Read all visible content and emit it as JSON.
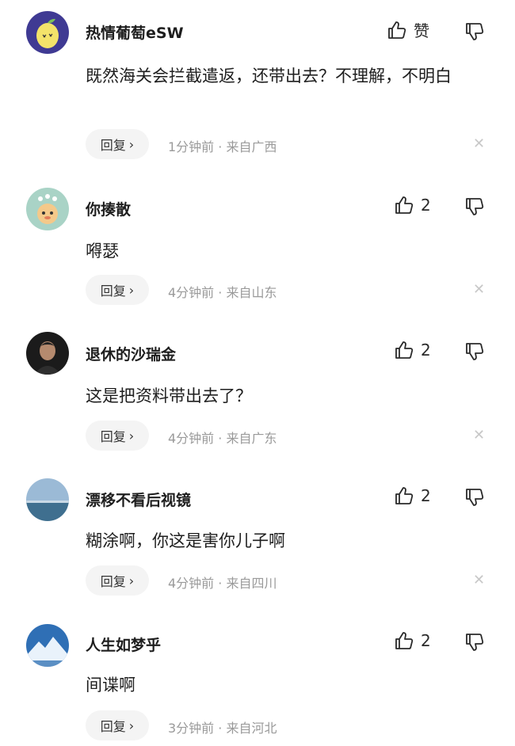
{
  "reply_label": "回复",
  "comments": [
    {
      "user": "热情葡萄eSW",
      "like_label": "赞",
      "text": "既然海关会拦截遣返，还带出去？不理解，不明白",
      "time": "1分钟前",
      "sep": "·",
      "location": "来自广西"
    },
    {
      "user": "你揍散",
      "like_label": "2",
      "text": "嘚瑟",
      "time": "4分钟前",
      "sep": "·",
      "location": "来自山东"
    },
    {
      "user": "退休的沙瑞金",
      "like_label": "2",
      "text": "这是把资料带出去了？",
      "time": "4分钟前",
      "sep": "·",
      "location": "来自广东"
    },
    {
      "user": "漂移不看后视镜",
      "like_label": "2",
      "text": "糊涂啊，你这是害你儿子啊",
      "time": "4分钟前",
      "sep": "·",
      "location": "来自四川"
    },
    {
      "user": "人生如梦乎",
      "like_label": "2",
      "text": "间谍啊",
      "time": "3分钟前",
      "sep": "·",
      "location": "来自河北"
    }
  ]
}
